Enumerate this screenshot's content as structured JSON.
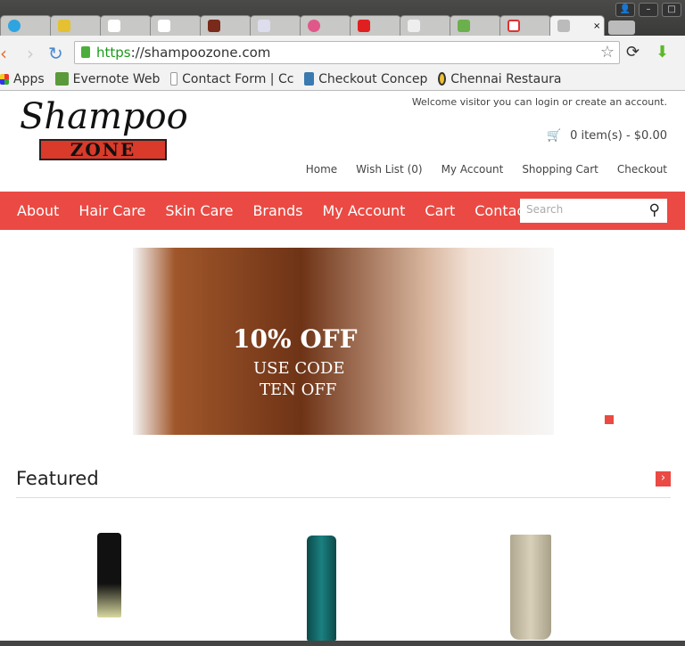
{
  "browser": {
    "tabs": [
      "telegram",
      "database",
      "document",
      "document",
      "avatar",
      "json",
      "dribbble",
      "youtube",
      "figure",
      "android",
      "gmail",
      "shopping-cart"
    ],
    "tab_close": "×",
    "url_scheme": "https",
    "url_rest": "://shampoozone.com",
    "bookmarks": [
      "Apps",
      "Evernote Web",
      "Contact Form | Cc",
      "Checkout Concep",
      "Chennai Restaura"
    ]
  },
  "site": {
    "logo_script": "Shampoo",
    "logo_zone": "ZONE",
    "welcome": "Welcome visitor you can login or create an account.",
    "cart": "0 item(s) - $0.00",
    "top_links": [
      "Home",
      "Wish List (0)",
      "My Account",
      "Shopping Cart",
      "Checkout"
    ],
    "nav": [
      "About",
      "Hair Care",
      "Skin Care",
      "Brands",
      "My Account",
      "Cart",
      "Contact us"
    ],
    "search_placeholder": "Search",
    "banner": {
      "line1": "10% OFF",
      "line2": "USE CODE",
      "line3": "TEN OFF"
    },
    "featured_title": "Featured",
    "featured_next": "›"
  }
}
